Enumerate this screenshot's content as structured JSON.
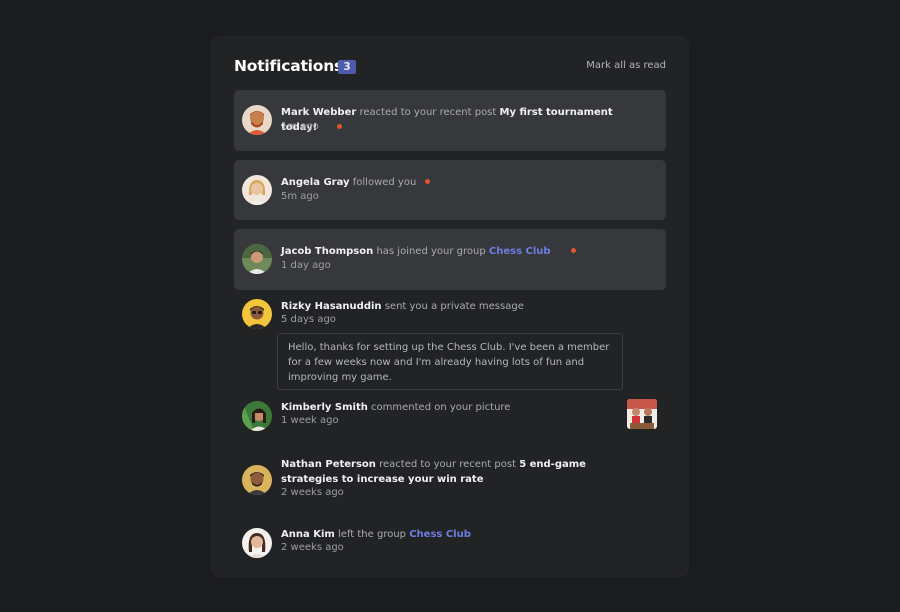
{
  "header": {
    "title": "Notifications",
    "unread_count": "3",
    "mark_all_label": "Mark all as read"
  },
  "notifications": [
    {
      "user": "Mark Webber",
      "action": "reacted to your recent post",
      "post": "My first tournament today!",
      "time": "1m ago",
      "unread": true,
      "avatar": "avatar-mark-webber"
    },
    {
      "user": "Angela Gray",
      "action": "followed you",
      "time": "5m ago",
      "unread": true,
      "avatar": "avatar-angela-gray"
    },
    {
      "user": "Jacob Thompson",
      "action": "has joined your group",
      "group": "Chess Club",
      "time": "1 day ago",
      "unread": true,
      "avatar": "avatar-jacob-thompson"
    },
    {
      "user": "Rizky Hasanuddin",
      "action": "sent you a private message",
      "time": "5 days ago",
      "unread": false,
      "message": "Hello, thanks for setting up the Chess Club. I've been a member for a few weeks now and I'm already having lots of fun and improving my game.",
      "avatar": "avatar-rizky-hasanuddin"
    },
    {
      "user": "Kimberly Smith",
      "action": "commented on your picture",
      "time": "1 week ago",
      "unread": false,
      "avatar": "avatar-kimberly-smith",
      "picture": "chess-picture-thumbnail"
    },
    {
      "user": "Nathan Peterson",
      "action": "reacted to your recent post",
      "post": "5 end-game strategies to increase your win rate",
      "time": "2 weeks ago",
      "unread": false,
      "avatar": "avatar-nathan-peterson"
    },
    {
      "user": "Anna Kim",
      "action": "left the group",
      "group": "Chess Club",
      "time": "2 weeks ago",
      "unread": false,
      "avatar": "avatar-anna-kim"
    }
  ],
  "colors": {
    "background": "#1b1c1e",
    "card": "#222325",
    "unread_row": "#37383b",
    "badge": "#4e5bad",
    "group_link": "#6e7ee0",
    "unread_dot": "#e0562d"
  }
}
